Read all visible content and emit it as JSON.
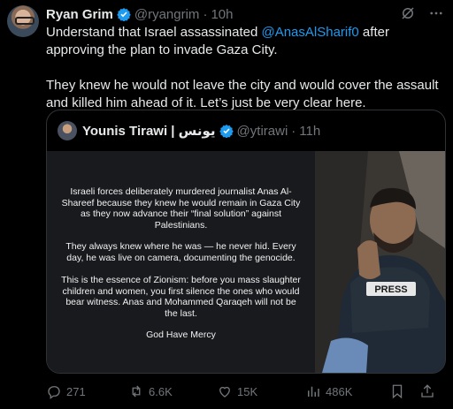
{
  "author": {
    "name": "Ryan Grim",
    "handle": "@ryangrim",
    "separator": "·",
    "time": "10h"
  },
  "post": {
    "text_before_mention": "Understand that Israel assassinated ",
    "mention": "@AnasAlSharif0",
    "text_after_mention": " after approving the plan to invade Gaza City.",
    "paragraph2": "They knew he would not leave the city and would cover the assault and killed him ahead of it. Let’s just be very clear here."
  },
  "quoted": {
    "name": "Younis Tirawi | يونس",
    "handle": "@ytirawi",
    "separator": "·",
    "time": "11h",
    "image_text": [
      "Israeli forces deliberately murdered journalist Anas Al-Shareef because they knew he would remain in Gaza City as they now advance their “final solution” against Palestinians.",
      "They always knew where he was — he never hid. Every day, he was live on camera, documenting the genocide.",
      "This is the essence of Zionism: before you mass slaughter children and women, you first silence the ones who would bear witness. Anas and Mohammed Qaraqeh will not be the last.",
      "God Have Mercy"
    ],
    "vest_label": "PRESS"
  },
  "actions": {
    "replies": "271",
    "reposts": "6.6K",
    "likes": "15K",
    "views": "486K"
  },
  "icons": {
    "verified": "verified-badge-icon",
    "grok": "grok-icon",
    "more": "more-icon",
    "reply": "reply-icon",
    "repost": "repost-icon",
    "like": "like-icon",
    "views": "views-icon",
    "bookmark": "bookmark-icon",
    "share": "share-icon"
  },
  "colors": {
    "background": "#000000",
    "text": "#e7e9ea",
    "secondary": "#71767b",
    "accent": "#1d9bf0",
    "border": "#2f3336"
  }
}
